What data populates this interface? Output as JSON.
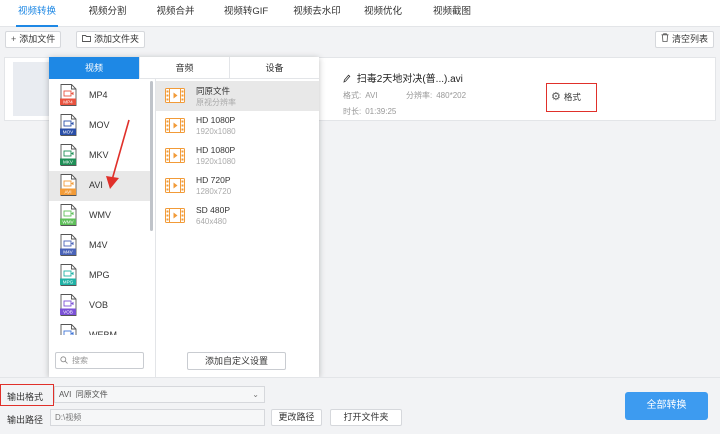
{
  "top_tabs": [
    {
      "label": "视频转换",
      "active": true
    },
    {
      "label": "视频分割",
      "active": false
    },
    {
      "label": "视频合并",
      "active": false
    },
    {
      "label": "视频转GIF",
      "active": false
    },
    {
      "label": "视频去水印",
      "active": false
    },
    {
      "label": "视频优化",
      "active": false
    },
    {
      "label": "视频截图",
      "active": false
    }
  ],
  "toolbar": {
    "add_file": "添加文件",
    "add_folder": "添加文件夹",
    "clear_list": "清空列表"
  },
  "file": {
    "name": "扫毒2天地对决(普...).avi",
    "format_label": "格式:",
    "format_value": "AVI",
    "resolution_label": "分辨率:",
    "resolution_value": "480*202",
    "duration_label": "时长:",
    "duration_value": "01:39:25",
    "format_button": "格式"
  },
  "panel": {
    "tabs": [
      {
        "label": "视频",
        "active": true
      },
      {
        "label": "音频",
        "active": false
      },
      {
        "label": "设备",
        "active": false
      }
    ],
    "formats": [
      {
        "label": "MP4",
        "icon": "mp4-file-icon",
        "color": "#e8533f",
        "selected": false
      },
      {
        "label": "MOV",
        "icon": "mov-file-icon",
        "color": "#2a4fa8",
        "selected": false
      },
      {
        "label": "MKV",
        "icon": "mkv-file-icon",
        "color": "#1f8f57",
        "selected": false
      },
      {
        "label": "AVI",
        "icon": "avi-file-icon",
        "color": "#f29b38",
        "selected": true
      },
      {
        "label": "WMV",
        "icon": "wmv-file-icon",
        "color": "#5fbf5a",
        "selected": false
      },
      {
        "label": "M4V",
        "icon": "m4v-file-icon",
        "color": "#4a63b8",
        "selected": false
      },
      {
        "label": "MPG",
        "icon": "mpg-file-icon",
        "color": "#20b2a6",
        "selected": false
      },
      {
        "label": "VOB",
        "icon": "vob-file-icon",
        "color": "#7b52d6",
        "selected": false
      },
      {
        "label": "WEBM",
        "icon": "webm-file-icon",
        "color": "#3d73d6",
        "selected": false
      }
    ],
    "qualities": [
      {
        "title": "同原文件",
        "sub": "原视分辨率",
        "selected": true
      },
      {
        "title": "HD 1080P",
        "sub": "1920x1080",
        "selected": false
      },
      {
        "title": "HD 1080P",
        "sub": "1920x1080",
        "selected": false
      },
      {
        "title": "HD 720P",
        "sub": "1280x720",
        "selected": false
      },
      {
        "title": "SD 480P",
        "sub": "640x480",
        "selected": false
      }
    ],
    "search_placeholder": "搜索",
    "custom_add": "添加自定义设置"
  },
  "bottom": {
    "output_format_label": "输出格式",
    "output_format_value": "AVI  同原文件",
    "output_path_label": "输出路径",
    "output_path_value": "D:\\视频",
    "change_path": "更改路径",
    "open_folder": "打开文件夹",
    "convert_all": "全部转换"
  },
  "colors": {
    "accent": "#1e88e5",
    "convert_button": "#3d9bf0",
    "highlight_red": "#e0302a"
  }
}
